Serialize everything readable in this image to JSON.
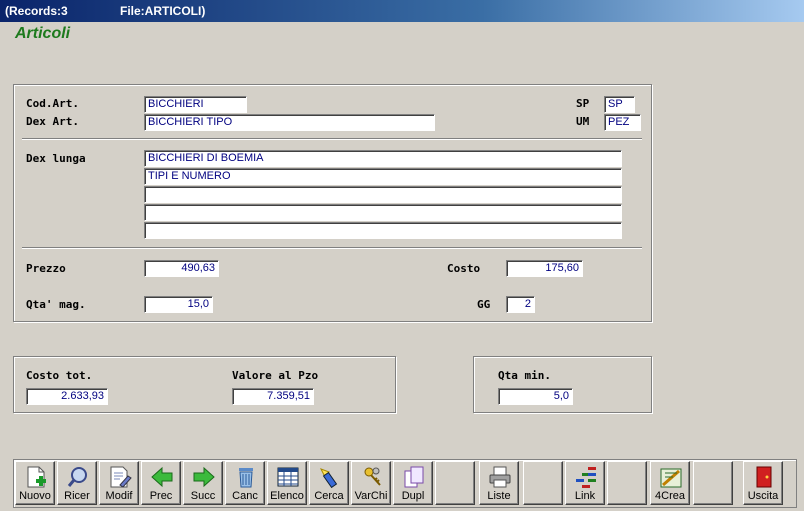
{
  "window": {
    "records": "(Records:3",
    "file": "File:ARTICOLI)"
  },
  "form_title": "Articoli",
  "fields": {
    "cod_art": {
      "label": "Cod.Art.",
      "value": "BICCHIERI"
    },
    "dex_art": {
      "label": "Dex Art.",
      "value": "BICCHIERI TIPO"
    },
    "sp": {
      "label": "SP",
      "value": "SP"
    },
    "um": {
      "label": "UM",
      "value": "PEZ"
    },
    "dex_lunga": {
      "label": "Dex lunga",
      "lines": [
        "BICCHIERI DI BOEMIA",
        "TIPI E NUMERO",
        "",
        "",
        ""
      ]
    },
    "prezzo": {
      "label": "Prezzo",
      "value": "490,63"
    },
    "costo": {
      "label": "Costo",
      "value": "175,60"
    },
    "qta_mag": {
      "label": "Qta' mag.",
      "value": "15,0"
    },
    "gg": {
      "label": "GG",
      "value": "2"
    }
  },
  "totals": {
    "costo_tot": {
      "label": "Costo tot.",
      "value": "2.633,93"
    },
    "valore_pzo": {
      "label": "Valore al Pzo",
      "value": "7.359,51"
    },
    "qta_min": {
      "label": "Qta min.",
      "value": "5,0"
    }
  },
  "toolbar": {
    "nuovo": "Nuovo",
    "ricer": "Ricer",
    "modif": "Modif",
    "prec": "Prec",
    "succ": "Succ",
    "canc": "Canc",
    "elenco": "Elenco",
    "cerca": "Cerca",
    "varchi": "VarChi",
    "dupl": "Dupl",
    "liste": "Liste",
    "link": "Link",
    "crea": "4Crea",
    "uscita": "Uscita"
  },
  "colors": {
    "title_green": "#1d7a1d",
    "field_text": "#000080",
    "window_bg": "#d4d0c8",
    "titlebar": "#0a246a"
  }
}
